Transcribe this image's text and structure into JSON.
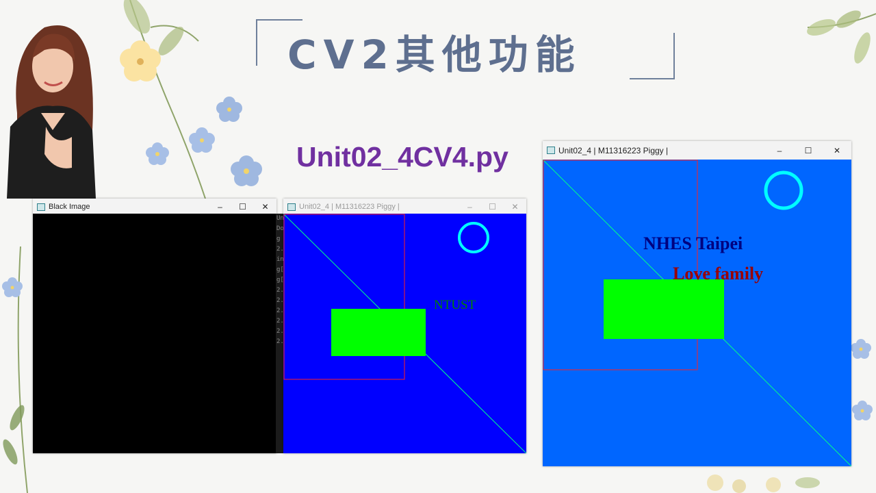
{
  "slide": {
    "title": "CV2其他功能",
    "filename": "Unit02_4CV4.py"
  },
  "window_black": {
    "title": "Black Image",
    "minimize": "–",
    "maximize": "☐",
    "close": "✕"
  },
  "window_small": {
    "title": "Unit02_4 | M11316223 Piggy |",
    "minimize": "–",
    "maximize": "☐",
    "close": "✕",
    "text_label": "NTUST",
    "background_color": "#0000ff"
  },
  "window_large": {
    "title": "Unit02_4 | M11316223 Piggy |",
    "minimize": "–",
    "maximize": "☐",
    "close": "✕",
    "text_line1": "NHES Taipei",
    "text_line2": "Love family",
    "background_color": "#0066ff"
  },
  "console": {
    "lines": [
      "Un",
      "Do",
      "g",
      "2.",
      "in",
      "g[",
      "g[",
      "2.",
      "2.",
      "2.",
      "2.",
      "2.",
      "2."
    ]
  },
  "colors": {
    "title": "#5e6f8f",
    "filename": "#7030a0",
    "rect_fill": "#00ff00",
    "circle": "#00ffff",
    "line": "#00ff88",
    "rect_outline": "#ff0000",
    "text_green": "#008000",
    "text_navy": "#000080",
    "text_red": "#990000"
  },
  "icons": [
    "app-icon",
    "minimize-icon",
    "maximize-icon",
    "close-icon",
    "flower-decoration",
    "presenter-photo"
  ]
}
